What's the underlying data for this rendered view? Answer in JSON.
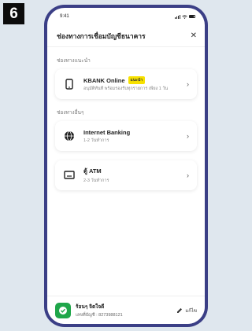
{
  "step_number": "6",
  "status_bar": {
    "time": "9:41"
  },
  "header": {
    "title": "ช่องทางการเชื่อมบัญชีธนาคาร",
    "close_icon": "close-icon"
  },
  "recommended": {
    "label": "ช่องทางแนะนำ",
    "item": {
      "title": "KBANK Online",
      "badge": "แนะนำ",
      "subtitle": "อนุมัติทันที พร้อมรองรับทุกรายการ เพียง 1 วัน",
      "icon": "mobile-phone-icon"
    }
  },
  "other": {
    "label": "ช่องทางอื่นๆ",
    "items": [
      {
        "title": "Internet Banking",
        "subtitle": "1-2 วันทำการ",
        "icon": "globe-icon"
      },
      {
        "title": "ตู้ ATM",
        "subtitle": "2-3 วันทำการ",
        "icon": "atm-icon"
      }
    ]
  },
  "footer": {
    "account_name": "ร้อนๆ จิตใจดี",
    "account_number": "เลขที่บัญชี : 8273988121",
    "edit_label": "แก้ไข",
    "avatar_icon": "shield-logo-icon"
  },
  "colors": {
    "badge": "#f7e100",
    "frame": "#3b3f86",
    "avatar": "#1fa64a",
    "background": "#dfe7ee"
  }
}
